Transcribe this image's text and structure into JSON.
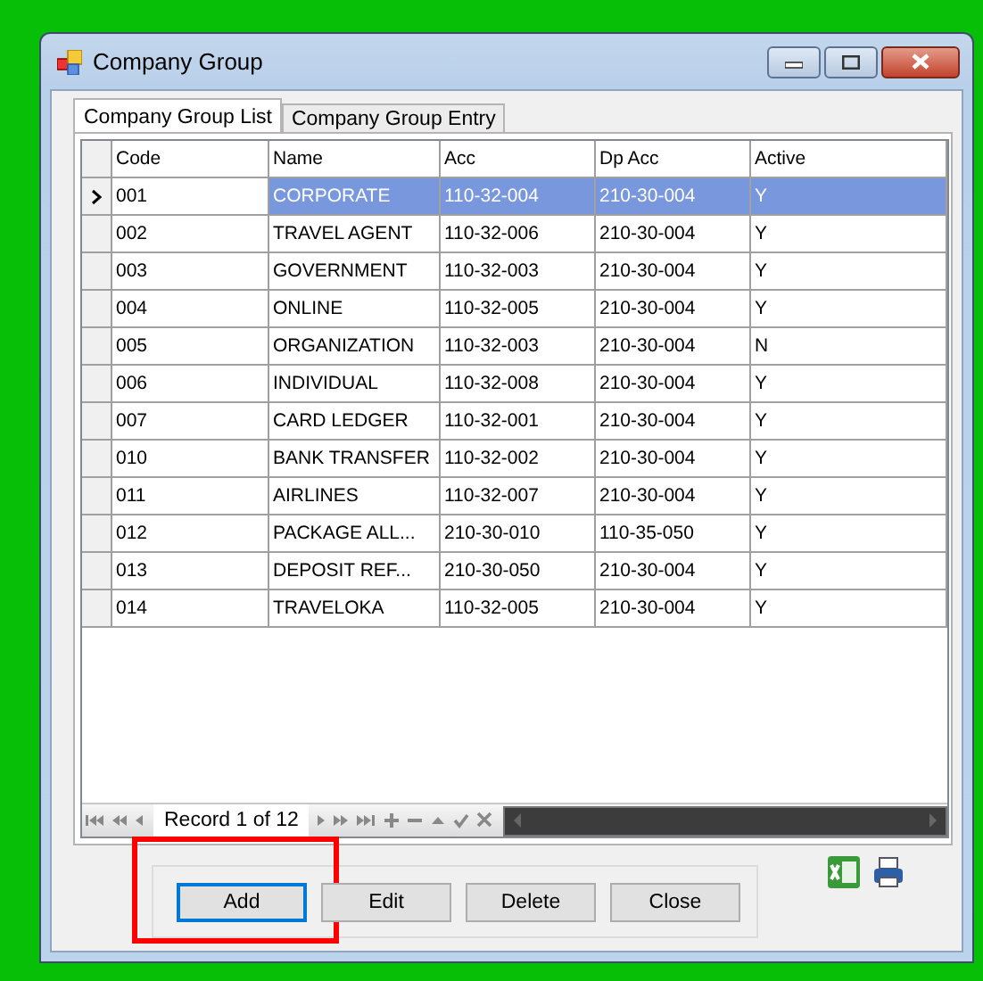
{
  "window": {
    "title": "Company Group"
  },
  "tabs": [
    {
      "label": "Company Group List",
      "selected": true
    },
    {
      "label": "Company Group Entry",
      "selected": false
    }
  ],
  "table": {
    "columns": [
      "Code",
      "Name",
      "Acc",
      "Dp Acc",
      "Active"
    ],
    "rows": [
      {
        "selected": true,
        "cells": [
          "001",
          "CORPORATE",
          "110-32-004",
          "210-30-004",
          "Y"
        ]
      },
      {
        "selected": false,
        "cells": [
          "002",
          "TRAVEL AGENT",
          "110-32-006",
          "210-30-004",
          "Y"
        ]
      },
      {
        "selected": false,
        "cells": [
          "003",
          "GOVERNMENT",
          "110-32-003",
          "210-30-004",
          "Y"
        ]
      },
      {
        "selected": false,
        "cells": [
          "004",
          "ONLINE",
          "110-32-005",
          "210-30-004",
          "Y"
        ]
      },
      {
        "selected": false,
        "cells": [
          "005",
          "ORGANIZATION",
          "110-32-003",
          "210-30-004",
          "N"
        ]
      },
      {
        "selected": false,
        "cells": [
          "006",
          "INDIVIDUAL",
          "110-32-008",
          "210-30-004",
          "Y"
        ]
      },
      {
        "selected": false,
        "cells": [
          "007",
          "CARD LEDGER",
          "110-32-001",
          "210-30-004",
          "Y"
        ]
      },
      {
        "selected": false,
        "cells": [
          "010",
          "BANK TRANSFER",
          "110-32-002",
          "210-30-004",
          "Y"
        ]
      },
      {
        "selected": false,
        "cells": [
          "011",
          "AIRLINES",
          "110-32-007",
          "210-30-004",
          "Y"
        ]
      },
      {
        "selected": false,
        "cells": [
          "012",
          "PACKAGE ALL...",
          "210-30-010",
          "110-35-050",
          "Y"
        ]
      },
      {
        "selected": false,
        "cells": [
          "013",
          "DEPOSIT REF...",
          "210-30-050",
          "210-30-004",
          "Y"
        ]
      },
      {
        "selected": false,
        "cells": [
          "014",
          "TRAVELOKA",
          "110-32-005",
          "210-30-004",
          "Y"
        ]
      }
    ]
  },
  "navigator": {
    "record": "Record 1 of 12"
  },
  "buttons": [
    {
      "label": "Add",
      "focused": true,
      "highlighted": true
    },
    {
      "label": "Edit",
      "focused": false,
      "highlighted": false
    },
    {
      "label": "Delete",
      "focused": false,
      "highlighted": false
    },
    {
      "label": "Close",
      "focused": false,
      "highlighted": false
    }
  ]
}
